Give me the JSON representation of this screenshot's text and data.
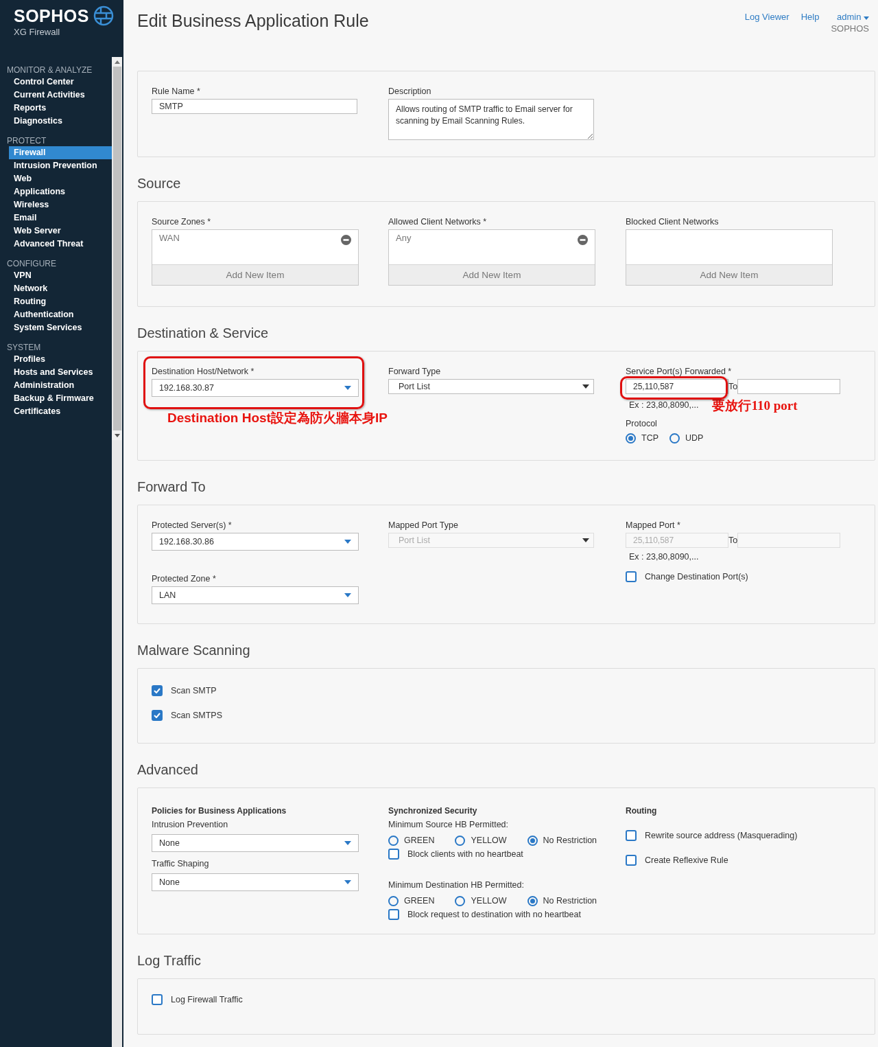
{
  "brand": {
    "logo": "SOPHOS",
    "product": "XG Firewall"
  },
  "sidebar": {
    "groups": [
      {
        "title": "MONITOR & ANALYZE",
        "items": [
          {
            "label": "Control Center",
            "selected": false
          },
          {
            "label": "Current Activities",
            "selected": false
          },
          {
            "label": "Reports",
            "selected": false
          },
          {
            "label": "Diagnostics",
            "selected": false
          }
        ]
      },
      {
        "title": "PROTECT",
        "items": [
          {
            "label": "Firewall",
            "selected": true
          },
          {
            "label": "Intrusion Prevention",
            "selected": false
          },
          {
            "label": "Web",
            "selected": false
          },
          {
            "label": "Applications",
            "selected": false
          },
          {
            "label": "Wireless",
            "selected": false
          },
          {
            "label": "Email",
            "selected": false
          },
          {
            "label": "Web Server",
            "selected": false
          },
          {
            "label": "Advanced Threat",
            "selected": false
          }
        ]
      },
      {
        "title": "CONFIGURE",
        "items": [
          {
            "label": "VPN",
            "selected": false
          },
          {
            "label": "Network",
            "selected": false
          },
          {
            "label": "Routing",
            "selected": false
          },
          {
            "label": "Authentication",
            "selected": false
          },
          {
            "label": "System Services",
            "selected": false
          }
        ]
      },
      {
        "title": "SYSTEM",
        "items": [
          {
            "label": "Profiles",
            "selected": false
          },
          {
            "label": "Hosts and Services",
            "selected": false
          },
          {
            "label": "Administration",
            "selected": false
          },
          {
            "label": "Backup & Firmware",
            "selected": false
          },
          {
            "label": "Certificates",
            "selected": false
          }
        ]
      }
    ]
  },
  "header": {
    "title": "Edit Business Application Rule",
    "links": [
      "Log Viewer",
      "Help"
    ],
    "user": "admin",
    "org": "SOPHOS"
  },
  "general": {
    "rule_name": {
      "label": "Rule Name *",
      "value": "SMTP"
    },
    "description": {
      "label": "Description",
      "value": "Allows routing of SMTP traffic to Email server for scanning by Email Scanning Rules."
    }
  },
  "source": {
    "heading": "Source",
    "lists": [
      {
        "label": "Source Zones *",
        "items": [
          "WAN"
        ],
        "add": "Add New Item"
      },
      {
        "label": "Allowed Client Networks *",
        "items": [
          "Any"
        ],
        "add": "Add New Item"
      },
      {
        "label": "Blocked Client Networks",
        "add": "Add New Item"
      }
    ]
  },
  "destination": {
    "heading": "Destination & Service",
    "host": {
      "label": "Destination Host/Network *",
      "value": "192.168.30.87",
      "highlighted": true
    },
    "forward_type": {
      "label": "Forward Type",
      "value": "Port List"
    },
    "ports": {
      "label": "Service Port(s) Forwarded *",
      "value": "25,110,587",
      "to": "To",
      "example": "Ex : 23,80,8090,...",
      "highlighted": true
    },
    "protocol": {
      "label": "Protocol",
      "options": [
        {
          "label": "TCP",
          "selected": true
        },
        {
          "label": "UDP",
          "selected": false
        }
      ]
    }
  },
  "forward_to": {
    "heading": "Forward To",
    "servers": {
      "label": "Protected Server(s) *",
      "value": "192.168.30.86"
    },
    "zone": {
      "label": "Protected Zone *",
      "value": "LAN"
    },
    "mapped_type": {
      "label": "Mapped Port Type",
      "value": "Port List",
      "disabled": true
    },
    "mapped_port": {
      "label": "Mapped Port *",
      "value": "25,110,587",
      "to": "To",
      "example": "Ex : 23,80,8090,...",
      "disabled": true
    },
    "change_port": {
      "label": "Change Destination Port(s)",
      "checked": false
    }
  },
  "malware": {
    "heading": "Malware Scanning",
    "options": [
      {
        "label": "Scan SMTP",
        "checked": true
      },
      {
        "label": "Scan SMTPS",
        "checked": true
      }
    ]
  },
  "advanced": {
    "heading": "Advanced",
    "policies": {
      "title": "Policies for Business Applications",
      "fields": [
        {
          "label": "Intrusion Prevention",
          "value": "None"
        },
        {
          "label": "Traffic Shaping",
          "value": "None"
        }
      ]
    },
    "sync": {
      "title": "Synchronized Security",
      "groups": [
        {
          "label": "Minimum Source HB Permitted:",
          "options": [
            {
              "label": "GREEN",
              "selected": false
            },
            {
              "label": "YELLOW",
              "selected": false
            },
            {
              "label": "No Restriction",
              "selected": true
            }
          ],
          "block": {
            "label": "Block clients with no heartbeat",
            "checked": false
          }
        },
        {
          "label": "Minimum Destination HB Permitted:",
          "options": [
            {
              "label": "GREEN",
              "selected": false
            },
            {
              "label": "YELLOW",
              "selected": false
            },
            {
              "label": "No Restriction",
              "selected": true
            }
          ],
          "block": {
            "label": "Block request to destination with no heartbeat",
            "checked": false
          }
        }
      ]
    },
    "routing": {
      "title": "Routing",
      "options": [
        {
          "label": "Rewrite source address (Masquerading)",
          "checked": false
        },
        {
          "label": "Create Reflexive Rule",
          "checked": false
        }
      ]
    }
  },
  "log": {
    "heading": "Log Traffic",
    "options": [
      {
        "label": "Log Firewall Traffic",
        "checked": false
      }
    ]
  },
  "annotations": [
    {
      "text": "Destination Host設定為防火牆本身IP"
    },
    {
      "text": "要放行110 port"
    }
  ]
}
